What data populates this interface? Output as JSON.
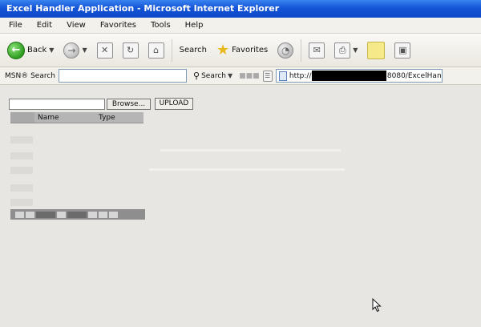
{
  "window": {
    "title": "Excel Handler Application - Microsoft Internet Explorer"
  },
  "menu": {
    "items": [
      "File",
      "Edit",
      "View",
      "Favorites",
      "Tools",
      "Help"
    ]
  },
  "toolbar": {
    "back_label": "Back",
    "search_label": "Search",
    "favorites_label": "Favorites"
  },
  "addressbar": {
    "msn_label": "MSN® Search",
    "search_label": "Search",
    "address_prefix": "http://",
    "address_suffix": "8080/ExcelHan"
  },
  "page": {
    "browse_label": "Browse...",
    "upload_label": "UPLOAD",
    "grid": {
      "columns": [
        "Name",
        "Type"
      ]
    }
  },
  "colors": {
    "title_bar": "#1455d6",
    "content_bg": "#e8e6e2"
  }
}
